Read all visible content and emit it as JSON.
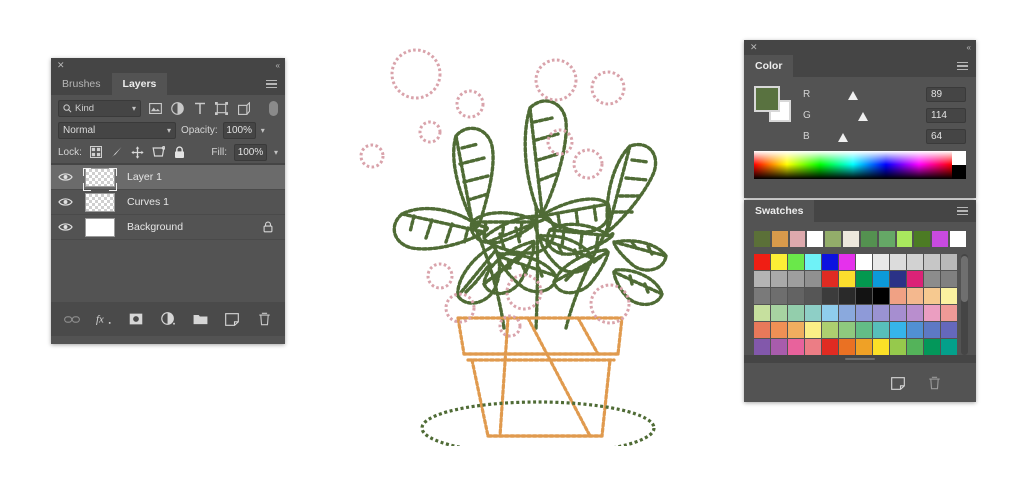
{
  "layers_panel": {
    "close_icon": "✕",
    "collapse_icon": "«",
    "tabs": [
      {
        "label": "Brushes",
        "active": false
      },
      {
        "label": "Layers",
        "active": true
      }
    ],
    "filter": {
      "kind_label": "Kind",
      "search_icon": "search-icon",
      "icons": [
        "image-filter-icon",
        "adjustment-filter-icon",
        "text-filter-icon",
        "shape-filter-icon",
        "smartobject-filter-icon"
      ],
      "toggle": "filter-toggle-pill"
    },
    "blend": {
      "mode": "Normal",
      "opacity_label": "Opacity:",
      "opacity_value": "100%"
    },
    "lock": {
      "label": "Lock:",
      "icons": [
        "lock-transparency-icon",
        "lock-paint-icon",
        "lock-move-icon",
        "lock-artboard-icon",
        "lock-all-icon"
      ],
      "fill_label": "Fill:",
      "fill_value": "100%"
    },
    "layers": [
      {
        "name": "Layer 1",
        "visible": true,
        "thumb": "checker",
        "selected": true,
        "locked": false
      },
      {
        "name": "Curves 1",
        "visible": true,
        "thumb": "checker",
        "selected": false,
        "locked": false
      },
      {
        "name": "Background",
        "visible": true,
        "thumb": "white",
        "selected": false,
        "locked": true
      }
    ],
    "toolbar_icons": [
      "link-layers-icon",
      "fx-icon",
      "add-mask-icon",
      "adjustment-layer-icon",
      "new-group-icon",
      "new-layer-icon",
      "delete-layer-icon"
    ],
    "fx_label": "fx"
  },
  "color_panel": {
    "close_icon": "✕",
    "collapse_icon": "«",
    "tab_label": "Color",
    "foreground_hex": "#59724 0",
    "foreground_color": "#597240",
    "background_color": "#ffffff",
    "channels": [
      {
        "label": "R",
        "value": "89",
        "pos_pct": 34.9,
        "ramp_from": "#007240",
        "ramp_to": "#ff7240"
      },
      {
        "label": "G",
        "value": "114",
        "pos_pct": 44.7,
        "ramp_from": "#590040",
        "ramp_to": "#59ff40"
      },
      {
        "label": "B",
        "value": "64",
        "pos_pct": 25.1,
        "ramp_from": "#597200",
        "ramp_to": "#5972ff"
      }
    ],
    "spectrum_white": "#ffffff",
    "spectrum_black": "#000000"
  },
  "swatches_panel": {
    "tab_label": "Swatches",
    "recent": [
      "#5b7038",
      "#d89a4b",
      "#dda9ad",
      "#ffffff",
      "#93ad6a",
      "#ece7dc",
      "#549150",
      "#65a866",
      "#a9e85e",
      "#4c7b24",
      "#c84ae0",
      "#ffffff"
    ],
    "grid": [
      [
        "#f01e14",
        "#fcee36",
        "#6ae84a",
        "#6ff2f7",
        "#0c12e0",
        "#e531ec",
        "#ffffff",
        "#e8e8e8",
        "#dcdcdc",
        "#d2d2d2",
        "#c6c6c6",
        "#b9b9b9"
      ],
      [
        "#b4b4b4",
        "#a9a9a9",
        "#9e9e9e",
        "#909090",
        "#e02b22",
        "#fbdd2d",
        "#03984f",
        "#0c9ad9",
        "#2b3287",
        "#db2277",
        "#8c8c8c",
        "#808080"
      ],
      [
        "#7a7a7a",
        "#6e6e6e",
        "#636363",
        "#565656",
        "#3c3c3c",
        "#2a2a2a",
        "#131313",
        "#000000",
        "#f0a184",
        "#f4b88e",
        "#f6c990",
        "#fbf2a0"
      ],
      [
        "#c6e09e",
        "#a7d3a1",
        "#93ceac",
        "#8ecfc6",
        "#8fcdec",
        "#8aa9dd",
        "#8e9ad8",
        "#9a93d2",
        "#a68ed0",
        "#b98ece",
        "#eb9ec1",
        "#ef9a97"
      ],
      [
        "#e8795a",
        "#ef9055",
        "#f0ae5f",
        "#fbef86",
        "#adcf70",
        "#8ec97e",
        "#63bd86",
        "#57bfbb",
        "#35b4ea",
        "#5190d3",
        "#5d79c4",
        "#6568bc"
      ],
      [
        "#8258ab",
        "#a85cac",
        "#e8629c",
        "#ec7d85",
        "#e02b22",
        "#ea7123",
        "#efa126",
        "#fbe027",
        "#96c94c",
        "#54b35a",
        "#03975a",
        "#04a08b"
      ]
    ],
    "toolbar_icons": [
      "new-swatch-icon",
      "delete-swatch-icon"
    ]
  },
  "artwork": {
    "name": "potted-plant-stitched-illustration",
    "leaf_color": "#4f6b35",
    "pot_color": "#e09a4e",
    "circle_color": "#d9a3ab",
    "background": "#ffffff"
  }
}
